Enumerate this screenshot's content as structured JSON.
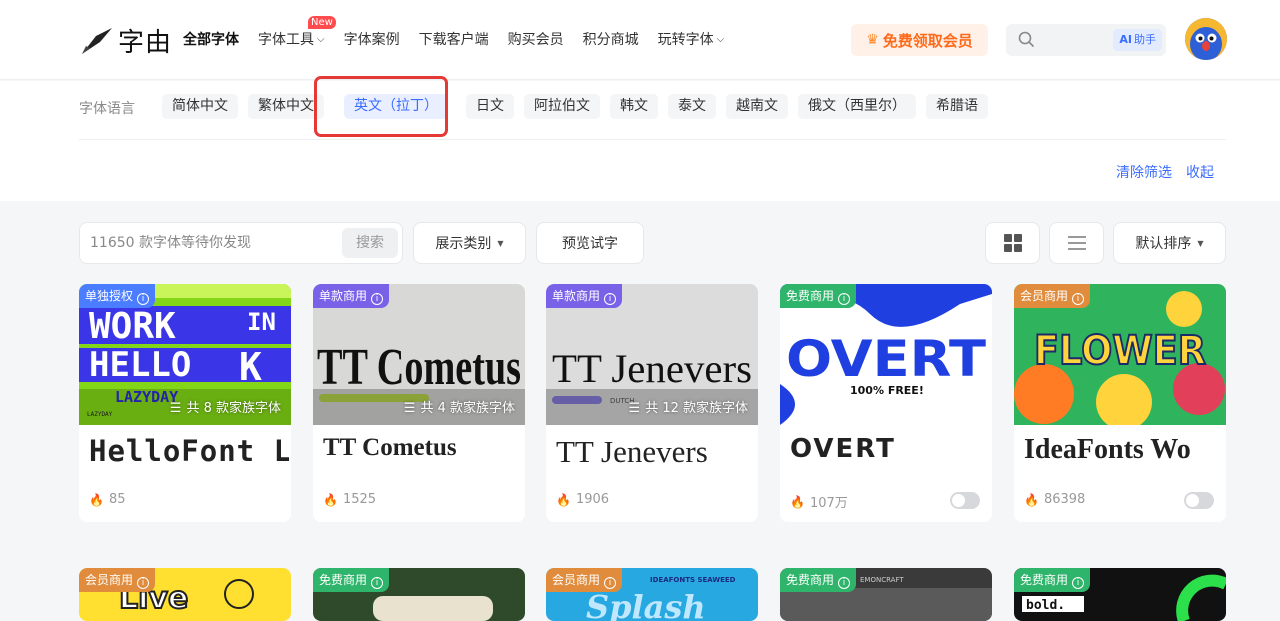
{
  "header": {
    "logo_text": "字由",
    "nav": [
      {
        "label": "全部字体",
        "active": true
      },
      {
        "label": "字体工具",
        "chevron": true,
        "badge": "New"
      },
      {
        "label": "字体案例"
      },
      {
        "label": "下载客户端"
      },
      {
        "label": "购买会员"
      },
      {
        "label": "积分商城"
      },
      {
        "label": "玩转字体",
        "chevron": true
      }
    ],
    "vip_button": "免费领取会员",
    "ai_label": "AI",
    "ai_sub": "助手"
  },
  "filter": {
    "label": "字体语言",
    "languages": [
      "简体中文",
      "繁体中文",
      "英文（拉丁）",
      "日文",
      "阿拉伯文",
      "韩文",
      "泰文",
      "越南文",
      "俄文（西里尔）",
      "希腊语"
    ],
    "selected": "英文（拉丁）",
    "clear": "清除筛选",
    "collapse": "收起"
  },
  "toolbar": {
    "search_placeholder": "11650 款字体等待你发现",
    "search_button": "搜索",
    "display_type": "展示类别",
    "preview": "预览试字",
    "sort": "默认排序"
  },
  "cards": [
    {
      "tag": "单独授权",
      "family": "共 8 款家族字体",
      "title": "HelloFont L",
      "count": "85"
    },
    {
      "tag": "单款商用",
      "family": "共 4 款家族字体",
      "title": "TT Cometus",
      "count": "1525"
    },
    {
      "tag": "单款商用",
      "family": "共 12 款家族字体",
      "title": "TT Jenevers",
      "count": "1906"
    },
    {
      "tag": "免费商用",
      "title": "OVERT",
      "count": "107万"
    },
    {
      "tag": "会员商用",
      "title": "IdeaFonts Wo",
      "count": "86398"
    }
  ],
  "cards_row2": [
    {
      "tag": "会员商用"
    },
    {
      "tag": "免费商用"
    },
    {
      "tag": "会员商用"
    },
    {
      "tag": "免费商用"
    },
    {
      "tag": "免费商用"
    }
  ],
  "thumb_text": {
    "hellofont": [
      "WORK",
      "IN",
      "HELLO",
      "K",
      "LAZYDAY",
      "LAZYDAY"
    ],
    "cometus": "TT Cometus",
    "jenevers": "TT Jenevers",
    "jenevers_small": "DUTCH",
    "overt": "OVERT",
    "overt_sub": "100% FREE!",
    "flower": "FLOWER",
    "live": "Live",
    "splash": "Splash",
    "splash_sub": "IDEAFONTS SEAWEED",
    "lemon": "EMONCRAFT",
    "bold": "bold."
  },
  "colors": {
    "accent": "#3b6cff",
    "vip": "#ff6a1a",
    "tag_purple": "#7a62e8",
    "tag_blue": "#4a7dff",
    "tag_green": "#2fb56b",
    "tag_orange": "#e08c3c",
    "highlight": "#e53935"
  }
}
